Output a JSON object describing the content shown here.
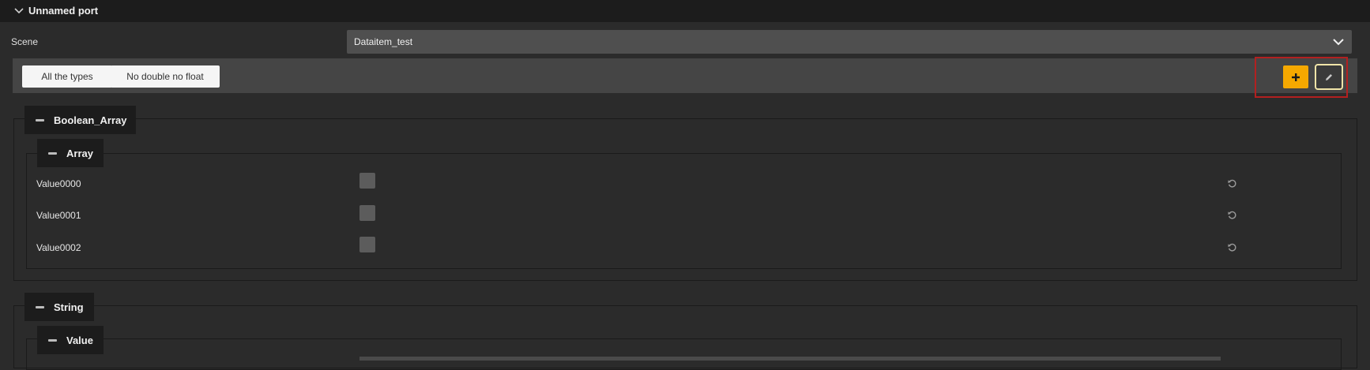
{
  "header": {
    "title": "Unnamed port",
    "collapse_icon": "chevron-down-icon"
  },
  "scene": {
    "label": "Scene",
    "value": "Dataitem_test",
    "dropdown_icon": "chevron-down-icon"
  },
  "filters": {
    "all_types": "All the types",
    "no_double_no_float": "No double no float"
  },
  "toolbar": {
    "add_icon": "plus-icon",
    "edit_icon": "pencil-icon",
    "add_color": "#f5a800",
    "highlight_color": "#b22020"
  },
  "groups": {
    "boolean_array": {
      "label": "Boolean_Array",
      "array": {
        "label": "Array",
        "rows": [
          {
            "label": "Value0000",
            "checked": false
          },
          {
            "label": "Value0001",
            "checked": false
          },
          {
            "label": "Value0002",
            "checked": false
          }
        ]
      }
    },
    "string": {
      "label": "String",
      "value": {
        "label": "Value"
      }
    }
  }
}
